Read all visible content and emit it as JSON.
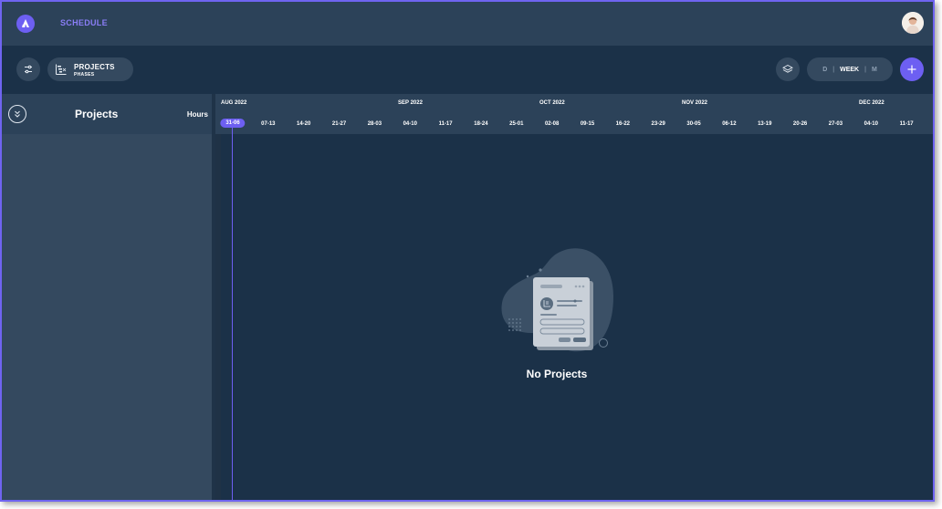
{
  "app": {
    "title": "SCHEDULE"
  },
  "toolbar": {
    "view_title": "PROJECTS",
    "view_subtitle": "PHASES",
    "scale_options": [
      "D",
      "WEEK",
      "M"
    ],
    "scale_separator": "|",
    "active_scale": "WEEK"
  },
  "left_panel": {
    "title": "Projects",
    "hours_label": "Hours"
  },
  "timeline": {
    "months": [
      "AUG 2022",
      "SEP 2022",
      "OCT 2022",
      "NOV 2022",
      "DEC 2022"
    ],
    "weeks": [
      "31-06",
      "07-13",
      "14-20",
      "21-27",
      "28-03",
      "04-10",
      "11-17",
      "18-24",
      "25-01",
      "02-08",
      "09-15",
      "16-22",
      "23-29",
      "30-05",
      "06-12",
      "13-19",
      "20-26",
      "27-03",
      "04-10",
      "11-17"
    ],
    "current_week": "31-06"
  },
  "empty_state": {
    "message": "No Projects"
  },
  "colors": {
    "accent": "#6d5ff2",
    "background": "#1b3148",
    "panel": "#34495f",
    "header": "#2c4259"
  }
}
